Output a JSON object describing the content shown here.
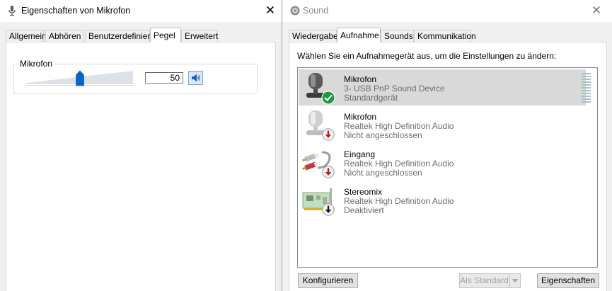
{
  "left_window": {
    "title": "Eigenschaften von Mikrofon",
    "close_glyph": "✕",
    "tabs": [
      {
        "label": "Allgemein",
        "active": false
      },
      {
        "label": "Abhören",
        "active": false
      },
      {
        "label": "Benutzerdefiniert",
        "active": false
      },
      {
        "label": "Pegel",
        "active": true
      },
      {
        "label": "Erweitert",
        "active": false
      }
    ],
    "level_group": {
      "label": "Mikrofon",
      "slider_level": 0.5,
      "value": "50",
      "speaker_icon": "speaker-icon"
    }
  },
  "right_window": {
    "title": "Sound",
    "close_glyph": "✕",
    "tabs": [
      {
        "label": "Wiedergabe",
        "active": false
      },
      {
        "label": "Aufnahme",
        "active": true
      },
      {
        "label": "Sounds",
        "active": false
      },
      {
        "label": "Kommunikation",
        "active": false
      }
    ],
    "instruction": "Wählen Sie ein Aufnahmegerät aus, um die Einstellungen zu ändern:",
    "devices": [
      {
        "name": "Mikrofon",
        "driver": "3- USB PnP Sound Device",
        "status": "Standardgerät",
        "icon": "microphone-icon",
        "badge": "default-check-icon",
        "selected": true
      },
      {
        "name": "Mikrofon",
        "driver": "Realtek High Definition Audio",
        "status": "Nicht angeschlossen",
        "icon": "microphone-icon",
        "badge": "unplugged-arrow-icon",
        "selected": false
      },
      {
        "name": "Eingang",
        "driver": "Realtek High Definition Audio",
        "status": "Nicht angeschlossen",
        "icon": "rca-cable-icon",
        "badge": "unplugged-arrow-icon",
        "selected": false
      },
      {
        "name": "Stereomix",
        "driver": "Realtek High Definition Audio",
        "status": "Deaktiviert",
        "icon": "sound-card-icon",
        "badge": "disabled-arrow-icon",
        "selected": false
      }
    ],
    "buttons": {
      "configure": "Konfigurieren",
      "set_default": "Als Standard",
      "properties": "Eigenschaften"
    },
    "colors": {
      "selection": "#d9d9d9",
      "check_badge": "#1a9a3a",
      "unplugged_arrow": "#d01010"
    }
  }
}
